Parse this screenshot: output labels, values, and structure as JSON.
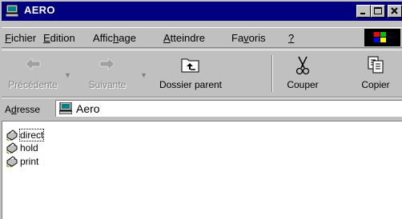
{
  "window": {
    "title": "AERO"
  },
  "menu": [
    {
      "pre": "",
      "key": "F",
      "post": "ichier"
    },
    {
      "pre": "",
      "key": "E",
      "post": "dition"
    },
    {
      "pre": "Affic",
      "key": "h",
      "post": "age"
    },
    {
      "pre": "",
      "key": "A",
      "post": "tteindre"
    },
    {
      "pre": "Fa",
      "key": "v",
      "post": "oris"
    },
    {
      "pre": "",
      "key": "?",
      "post": ""
    }
  ],
  "toolbar": {
    "back": "Précédente",
    "forward": "Suivante",
    "up": "Dossier parent",
    "cut": "Couper",
    "copy": "Copier"
  },
  "address": {
    "label_pre": "A",
    "label_key": "d",
    "label_post": "resse",
    "value": "Aero"
  },
  "files": [
    "direct",
    "hold",
    "print"
  ],
  "colors": {
    "titlebar": "#000080",
    "face": "#c0c0c0",
    "disabled": "#808080"
  },
  "icons": {
    "app": "computer-icon",
    "back": "back-arrow-icon",
    "forward": "forward-arrow-icon",
    "up": "folder-up-icon",
    "cut": "scissors-icon",
    "copy": "copy-icon",
    "file": "network-printer-icon"
  }
}
